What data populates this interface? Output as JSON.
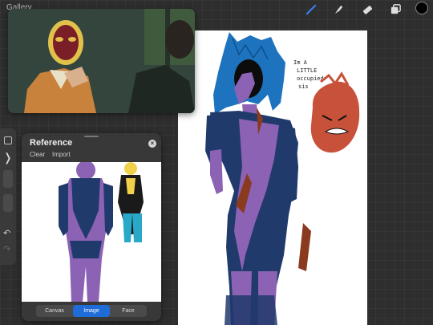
{
  "toolbar": {
    "gallery_label": "Gallery",
    "tools": [
      {
        "name": "brush-icon",
        "active": true
      },
      {
        "name": "smudge-icon",
        "active": false
      },
      {
        "name": "eraser-icon",
        "active": false
      },
      {
        "name": "layers-icon",
        "active": false
      }
    ],
    "color": "#000000",
    "active_tool_color": "#3b82f6"
  },
  "canvas": {
    "handwriting": [
      "Im A",
      "LITTLE",
      "occupied",
      "sis"
    ]
  },
  "reference": {
    "title": "Reference",
    "clear_label": "Clear",
    "import_label": "Import",
    "close_label": "×",
    "tabs": [
      {
        "label": "Canvas",
        "active": false
      },
      {
        "label": "Image",
        "active": true
      },
      {
        "label": "Face",
        "active": false
      }
    ]
  },
  "sidebar": {
    "expand_label": "❭",
    "undo_label": "↶",
    "redo_label": "↷"
  }
}
